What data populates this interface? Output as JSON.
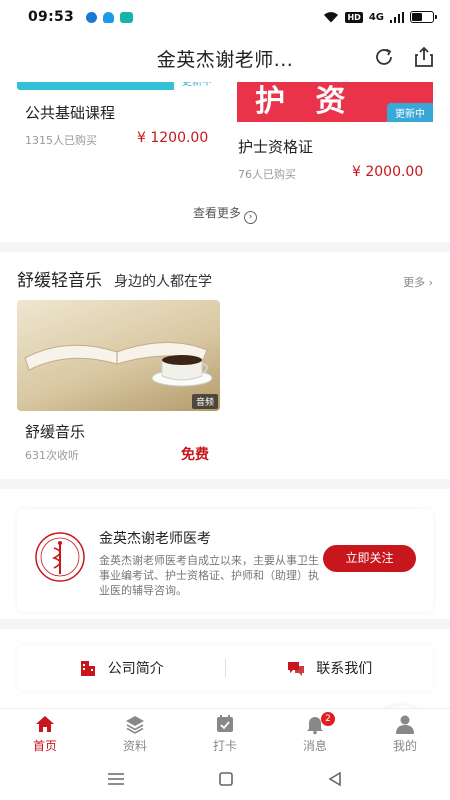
{
  "status_bar": {
    "time": "09:53",
    "hd": "HD",
    "signal": "4G",
    "battery_level": 0.55
  },
  "header": {
    "title": "金英杰谢老师..."
  },
  "courses": {
    "items": [
      {
        "name": "公共基础课程",
        "buyers": "1315人已购买",
        "price": "¥ 1200.00",
        "tag": "更新中"
      },
      {
        "name": "护士资格证",
        "buyers": "76人已购买",
        "price": "¥ 2000.00",
        "tag": "更新中",
        "thumb_text": "护 资"
      }
    ],
    "view_more": "查看更多"
  },
  "music": {
    "title": "舒缓轻音乐",
    "subtitle": "身边的人都在学",
    "more": "更多",
    "item": {
      "name": "舒缓音乐",
      "plays": "631次收听",
      "price": "免费",
      "tag": "音频"
    }
  },
  "follow": {
    "name": "金英杰谢老师医考",
    "description": "金英杰谢老师医考自成立以来，主要从事卫生事业编考试、护士资格证、护师和（助理）执业医的辅导咨询。",
    "button": "立即关注"
  },
  "links": {
    "company": "公司简介",
    "contact": "联系我们"
  },
  "tabs": [
    {
      "label": "首页",
      "active": true
    },
    {
      "label": "资料"
    },
    {
      "label": "打卡"
    },
    {
      "label": "消息",
      "badge": "2"
    },
    {
      "label": "我的"
    }
  ],
  "colors": {
    "accent": "#c8161d",
    "thumb_blue": "#34c0d8",
    "tag_blue": "#3aa8d6"
  }
}
